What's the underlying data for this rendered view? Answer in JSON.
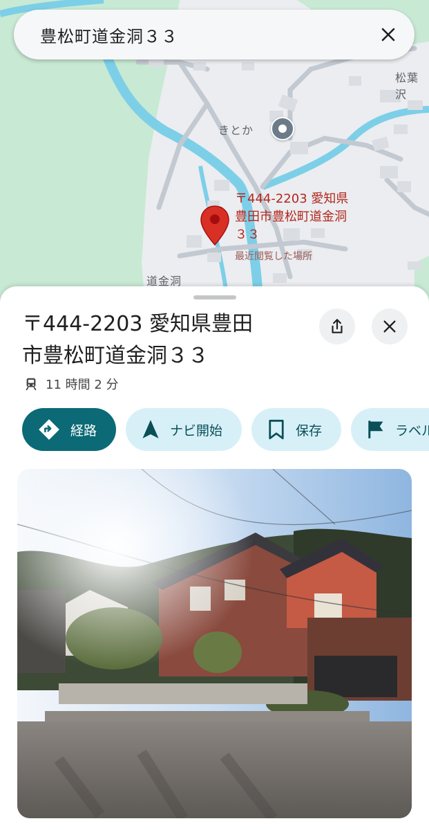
{
  "search": {
    "query": "豊松町道金洞３３"
  },
  "map": {
    "labels": {
      "poi": "きとか",
      "area_right": "松葉沢",
      "area_bottom": "道金洞"
    },
    "place_label_lines": [
      "〒444-2203 愛知県",
      "豊田市豊松町道金洞",
      "３３"
    ],
    "place_sub": "最近閲覧した場所"
  },
  "sheet": {
    "title_lines": [
      "〒444-2203 愛知県豊田",
      "市豊松町道金洞３３"
    ],
    "transit": "11 時間 2 分",
    "actions": [
      {
        "label": "経路",
        "icon": "directions-icon"
      },
      {
        "label": "ナビ開始",
        "icon": "navigation-arrow-icon"
      },
      {
        "label": "保存",
        "icon": "bookmark-icon"
      },
      {
        "label": "ラベル",
        "icon": "flag-icon"
      }
    ]
  },
  "colors": {
    "primary_chip": "#0b6a75",
    "chip_bg": "#d7f0f8",
    "pin_red": "#d93025",
    "water": "#7dcfe8",
    "park": "#c8e9d3"
  }
}
